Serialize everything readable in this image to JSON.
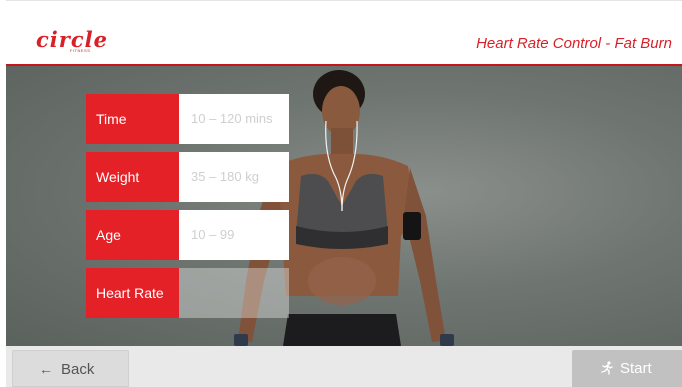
{
  "header": {
    "logo_text": "circle",
    "logo_subtext": "FITNESS",
    "program_title": "Heart Rate Control - Fat Burn",
    "accent_color": "#d92027"
  },
  "form": {
    "fields": [
      {
        "label": "Time",
        "value": "10 – 120 mins"
      },
      {
        "label": "Weight",
        "value": "35 – 180 kg"
      },
      {
        "label": "Age",
        "value": "10 – 99"
      },
      {
        "label": "Heart Rate",
        "value": ""
      }
    ]
  },
  "footer": {
    "back_label": "Back",
    "back_icon": "arrow-left-icon",
    "start_label": "Start",
    "start_icon": "running-person-icon"
  }
}
